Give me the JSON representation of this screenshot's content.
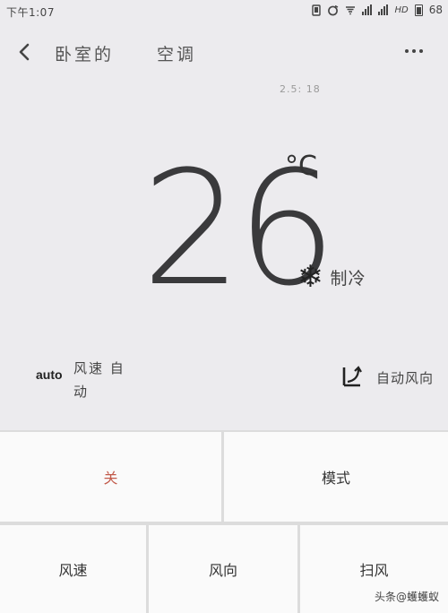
{
  "status_bar": {
    "time": "下午1:07",
    "network_label": "HD",
    "battery": "68"
  },
  "header": {
    "room": "卧室的",
    "device": "空调"
  },
  "sub_info": "2.5: 18",
  "display": {
    "temperature": "26",
    "unit": "°C",
    "mode_icon": "snowflake-icon",
    "mode_label": "制冷"
  },
  "fan": {
    "auto_badge": "auto",
    "label": "风速 自动"
  },
  "swing": {
    "label": "自动风向"
  },
  "controls": {
    "off": "关",
    "mode": "模式",
    "speed": "风速",
    "direction": "风向",
    "swing": "扫风"
  },
  "watermark": "头条@蠖蠖蚁",
  "colors": {
    "background": "#ecebee",
    "off_button_text": "#c25a4a",
    "button_background": "#fafafa"
  }
}
